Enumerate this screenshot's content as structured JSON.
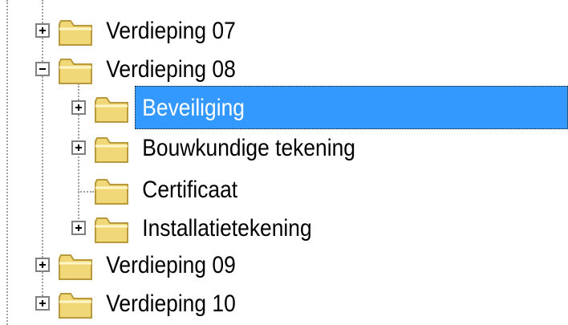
{
  "tree": {
    "nodes": [
      {
        "label": "Verdieping 07",
        "expander": "plus",
        "level": 0
      },
      {
        "label": "Verdieping 08",
        "expander": "minus",
        "level": 0
      },
      {
        "label": "Beveiliging",
        "expander": "plus",
        "level": 1,
        "selected": true
      },
      {
        "label": "Bouwkundige tekening",
        "expander": "plus",
        "level": 1
      },
      {
        "label": "Certificaat",
        "expander": "none",
        "level": 1
      },
      {
        "label": "Installatietekening",
        "expander": "plus",
        "level": 1
      },
      {
        "label": "Verdieping 09",
        "expander": "plus",
        "level": 0
      },
      {
        "label": "Verdieping 10",
        "expander": "plus",
        "level": 0
      }
    ],
    "colors": {
      "selection": "#3399ff",
      "folder": "#f0d878",
      "folder_outline": "#b89a3c"
    },
    "icon": "folder-icon"
  }
}
